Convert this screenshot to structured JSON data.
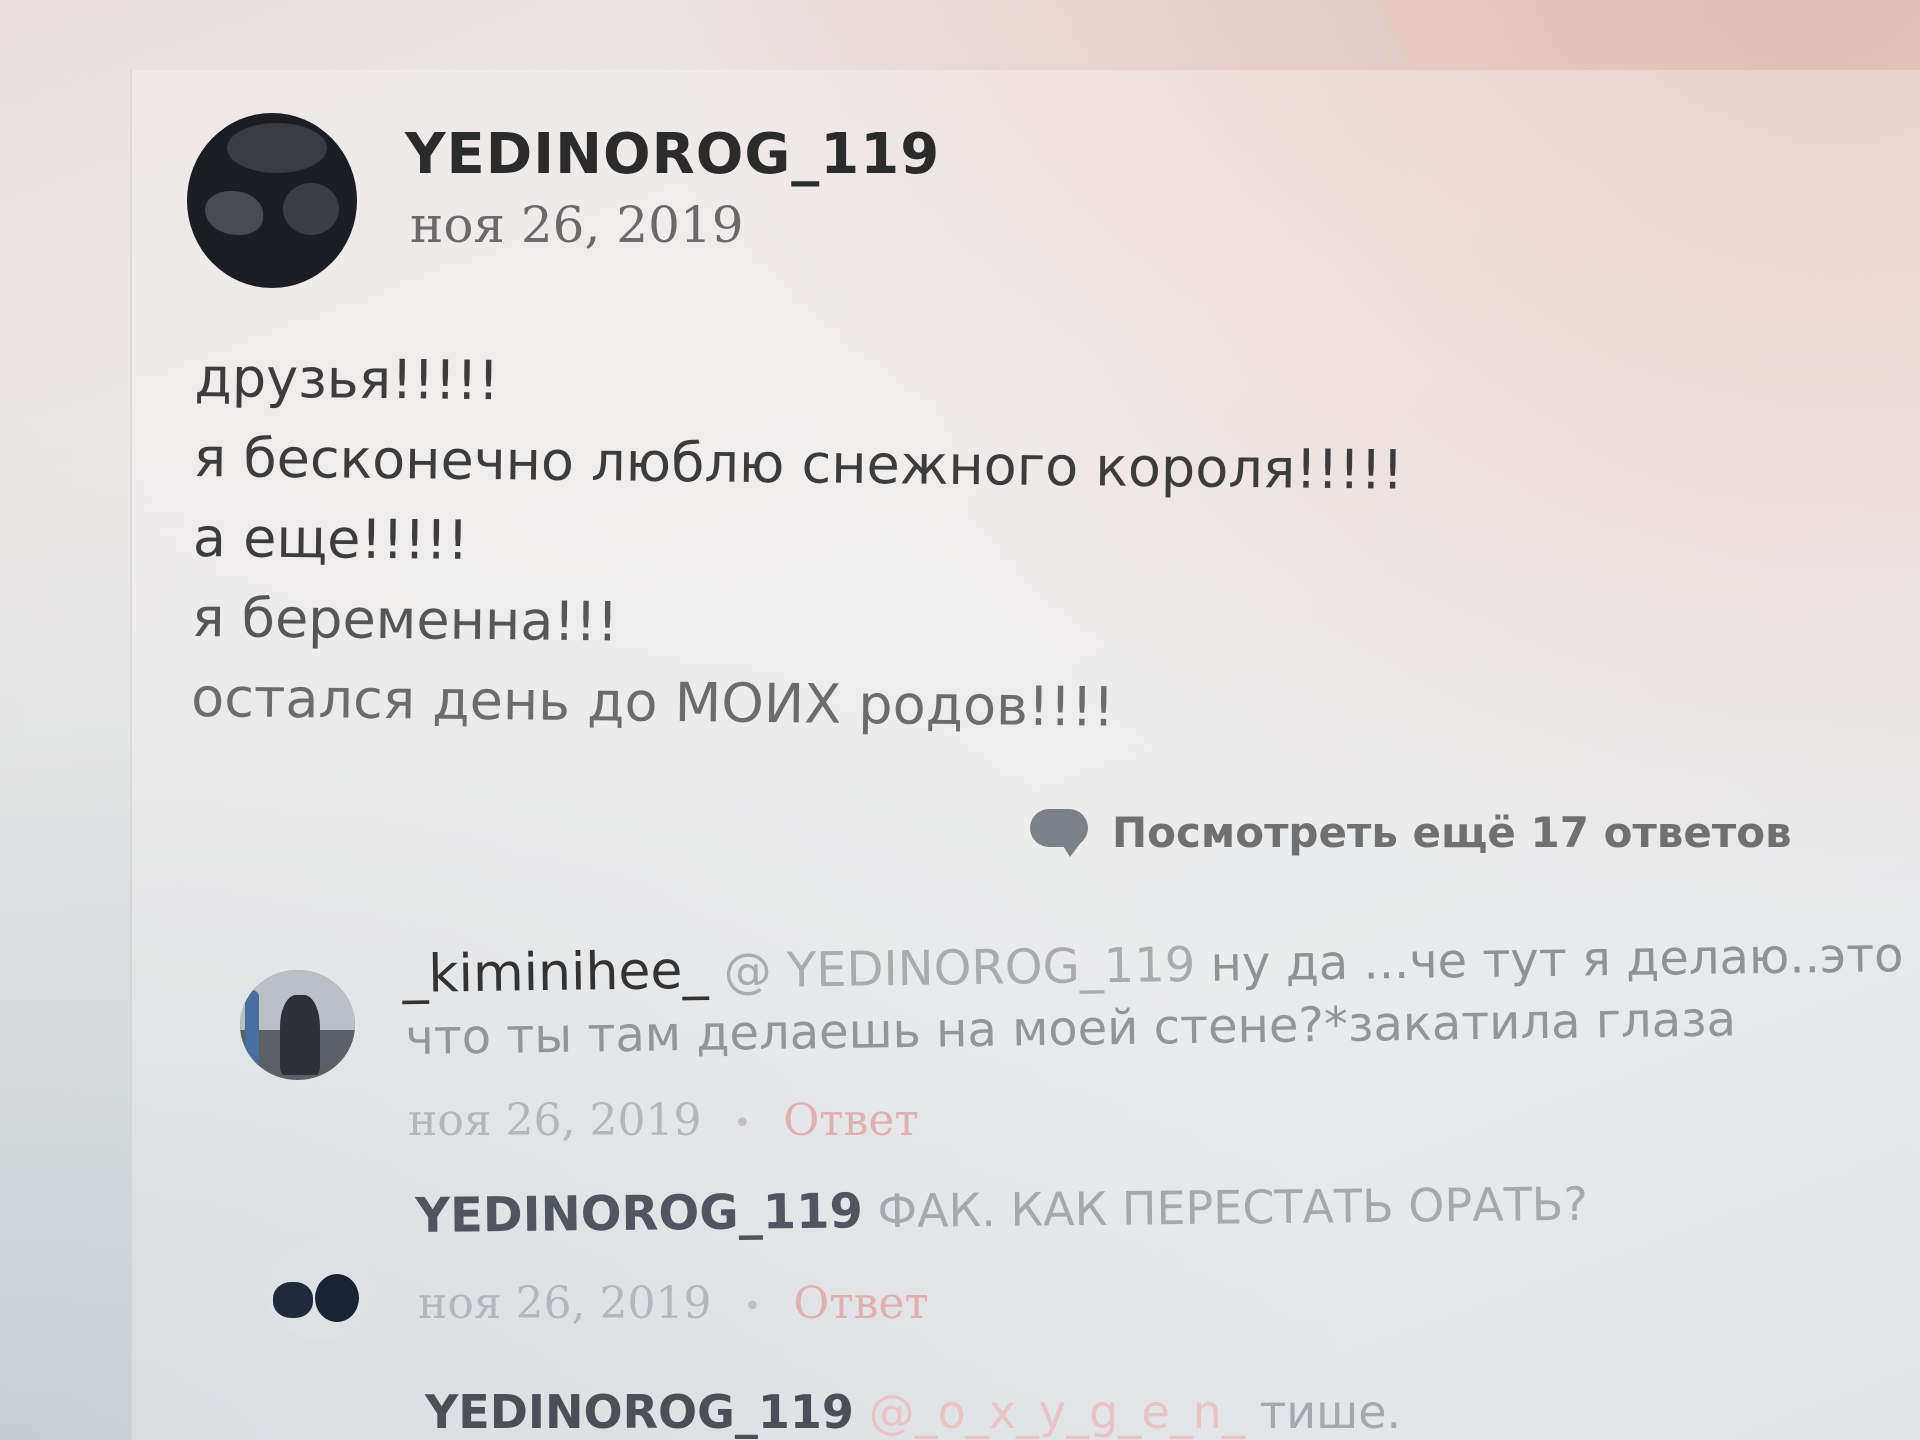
{
  "post": {
    "username": "YEDINOROG_119",
    "date": "ноя 26, 2019",
    "lines": [
      "друзья!!!!!",
      "я бесконечно люблю снежного короля!!!!!",
      "а еще!!!!!",
      "я беременна!!!",
      "остался день до МОИХ родов!!!!"
    ]
  },
  "more_replies": {
    "label": "Посмотреть ещё 17 ответов",
    "icon": "speech-bubble-icon"
  },
  "replies": [
    {
      "username": "_kiminihee_",
      "mention": "@ YEDINOROG_119",
      "text_line1": "ну да ...че тут я делаю..это я д",
      "text_line2": "что ты там делаешь на моей стене?*закатила глаза",
      "date": "ноя 26, 2019",
      "separator": "•",
      "reply_label": "Ответ"
    },
    {
      "username": "YEDINOROG_119",
      "text": "ФАК. КАК ПЕРЕСТАТЬ ОРАТЬ?",
      "date": "ноя 26, 2019",
      "separator": "•",
      "reply_label": "Ответ"
    },
    {
      "username": "YEDINOROG_119",
      "mention": "@_o_x_y_g_e_n_",
      "text": "тише."
    }
  ],
  "colors": {
    "accent_reply_link": "#e0b0b0",
    "username_text": "#2b2b2b",
    "meta_text": "#b3b6ba"
  }
}
